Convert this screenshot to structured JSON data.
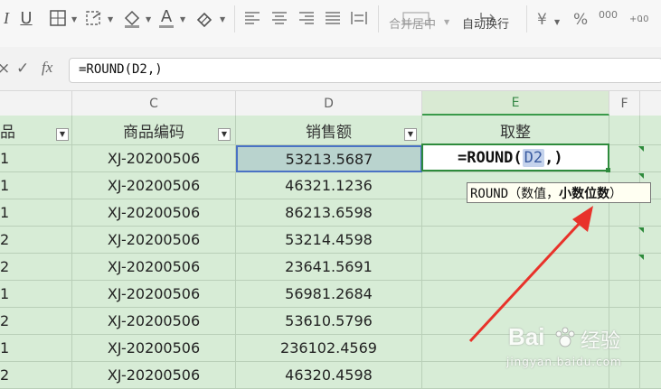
{
  "toolbar": {
    "merge_center_label": "合并居中",
    "wrap_text_label": "自动换行",
    "currency_symbol": "¥",
    "percent_symbol": "%",
    "thousand_label": "000",
    "font_color_letter": "A",
    "underline_letter": "U"
  },
  "formula_bar": {
    "cancel_symbol": "×",
    "confirm_symbol": "✓",
    "fx_label": "fx",
    "formula": "=ROUND(D2,)"
  },
  "columns": {
    "b_header": "",
    "c_header": "C",
    "d_header": "D",
    "e_header": "E",
    "f_header": "F"
  },
  "table": {
    "headers": [
      "品",
      "商品编码",
      "销售额",
      "取整"
    ],
    "rows": [
      {
        "b": "1",
        "code": "XJ-20200506",
        "sales": "53213.5687"
      },
      {
        "b": "1",
        "code": "XJ-20200506",
        "sales": "46321.1236"
      },
      {
        "b": "1",
        "code": "XJ-20200506",
        "sales": "86213.6598"
      },
      {
        "b": "2",
        "code": "XJ-20200506",
        "sales": "53214.4598"
      },
      {
        "b": "2",
        "code": "XJ-20200506",
        "sales": "23641.5691"
      },
      {
        "b": "1",
        "code": "XJ-20200506",
        "sales": "56981.2684"
      },
      {
        "b": "2",
        "code": "XJ-20200506",
        "sales": "53610.5796"
      },
      {
        "b": "1",
        "code": "XJ-20200506",
        "sales": "236102.4569"
      },
      {
        "b": "2",
        "code": "XJ-20200506",
        "sales": "46320.4598"
      }
    ]
  },
  "editing_cell": {
    "prefix": "=ROUND(",
    "ref": "D2",
    "suffix": ",)"
  },
  "tooltip": {
    "func": "ROUND（数值，",
    "bold_arg": "小数位数",
    "close": "）"
  },
  "watermark": {
    "brand": "Bai",
    "brand2": "经验",
    "url": "jingyan.baidu.com"
  },
  "colors": {
    "grid_bg": "#d7ecd6",
    "selected_cell": "#b9d3ce",
    "active_border": "#2e8b3c",
    "arrow": "#e8322a",
    "ref_highlight": "#c5d3ec"
  }
}
